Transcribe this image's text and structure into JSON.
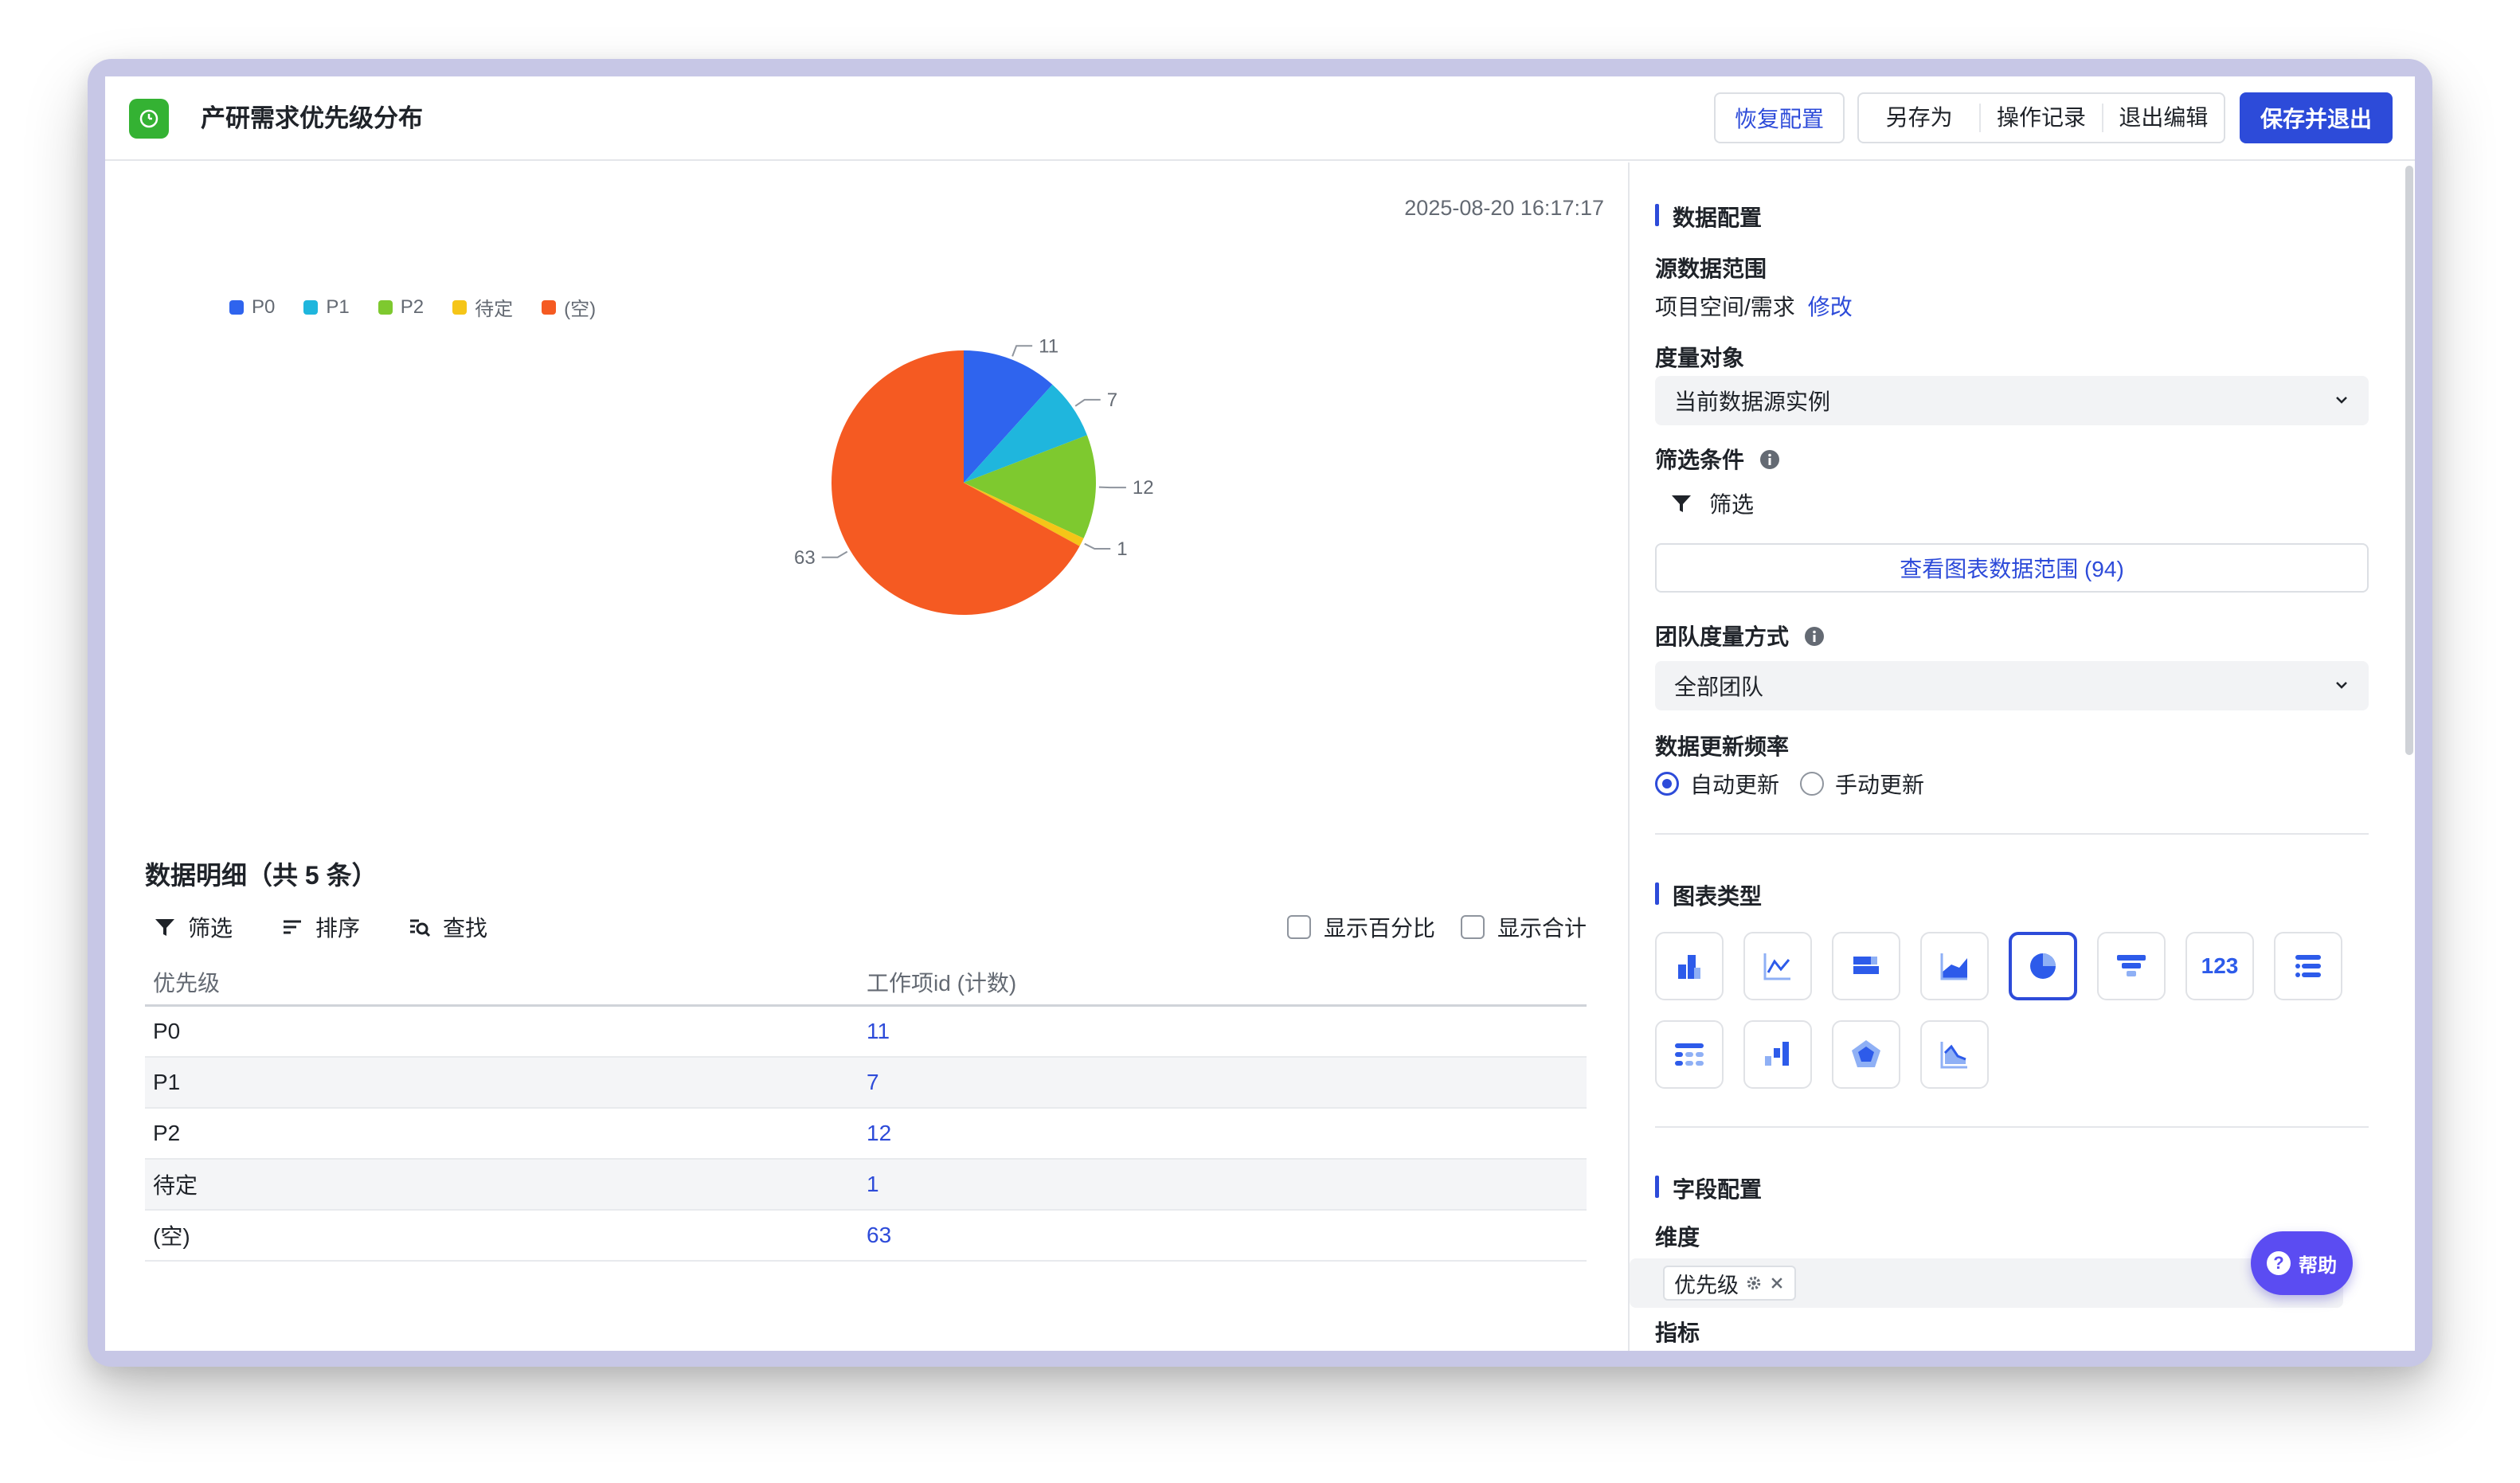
{
  "header": {
    "title": "产研需求优先级分布",
    "buttons": {
      "restore": "恢复配置",
      "save_as": "另存为",
      "history": "操作记录",
      "exit_edit": "退出编辑",
      "save_exit": "保存并退出"
    }
  },
  "chart": {
    "timestamp": "2025-08-20 16:17:17"
  },
  "chart_data": {
    "type": "pie",
    "categories": [
      "P0",
      "P1",
      "P2",
      "待定",
      "(空)"
    ],
    "values": [
      11,
      7,
      12,
      1,
      63
    ],
    "colors": [
      "#2f64ee",
      "#1fb6dd",
      "#7ec92f",
      "#f5c518",
      "#f55a22"
    ],
    "legend": "top-left",
    "data_labels": [
      "11",
      "7",
      "12",
      "1",
      "63"
    ]
  },
  "details": {
    "title": "数据明细（共 5 条）",
    "toolbar": {
      "filter": "筛选",
      "sort": "排序",
      "search": "查找"
    },
    "checks": {
      "percent": "显示百分比",
      "total": "显示合计"
    },
    "columns": [
      "优先级",
      "工作项id (计数)"
    ],
    "rows": [
      {
        "name": "P0",
        "value": "11"
      },
      {
        "name": "P1",
        "value": "7"
      },
      {
        "name": "P2",
        "value": "12"
      },
      {
        "name": "待定",
        "value": "1"
      },
      {
        "name": "(空)",
        "value": "63"
      }
    ]
  },
  "config": {
    "data_section": "数据配置",
    "source_label": "源数据范围",
    "source_value": "项目空间/需求",
    "source_edit": "修改",
    "measure_label": "度量对象",
    "measure_value": "当前数据源实例",
    "filter_label": "筛选条件",
    "filter_action": "筛选",
    "view_range": "查看图表数据范围 (94)",
    "team_label": "团队度量方式",
    "team_value": "全部团队",
    "freq_label": "数据更新频率",
    "freq_auto": "自动更新",
    "freq_manual": "手动更新",
    "chart_section": "图表类型",
    "chart_number_label": "123",
    "field_section": "字段配置",
    "dimension_label": "维度",
    "dimension_tag": "优先级",
    "metric_label": "指标"
  },
  "help": {
    "label": "帮助"
  }
}
